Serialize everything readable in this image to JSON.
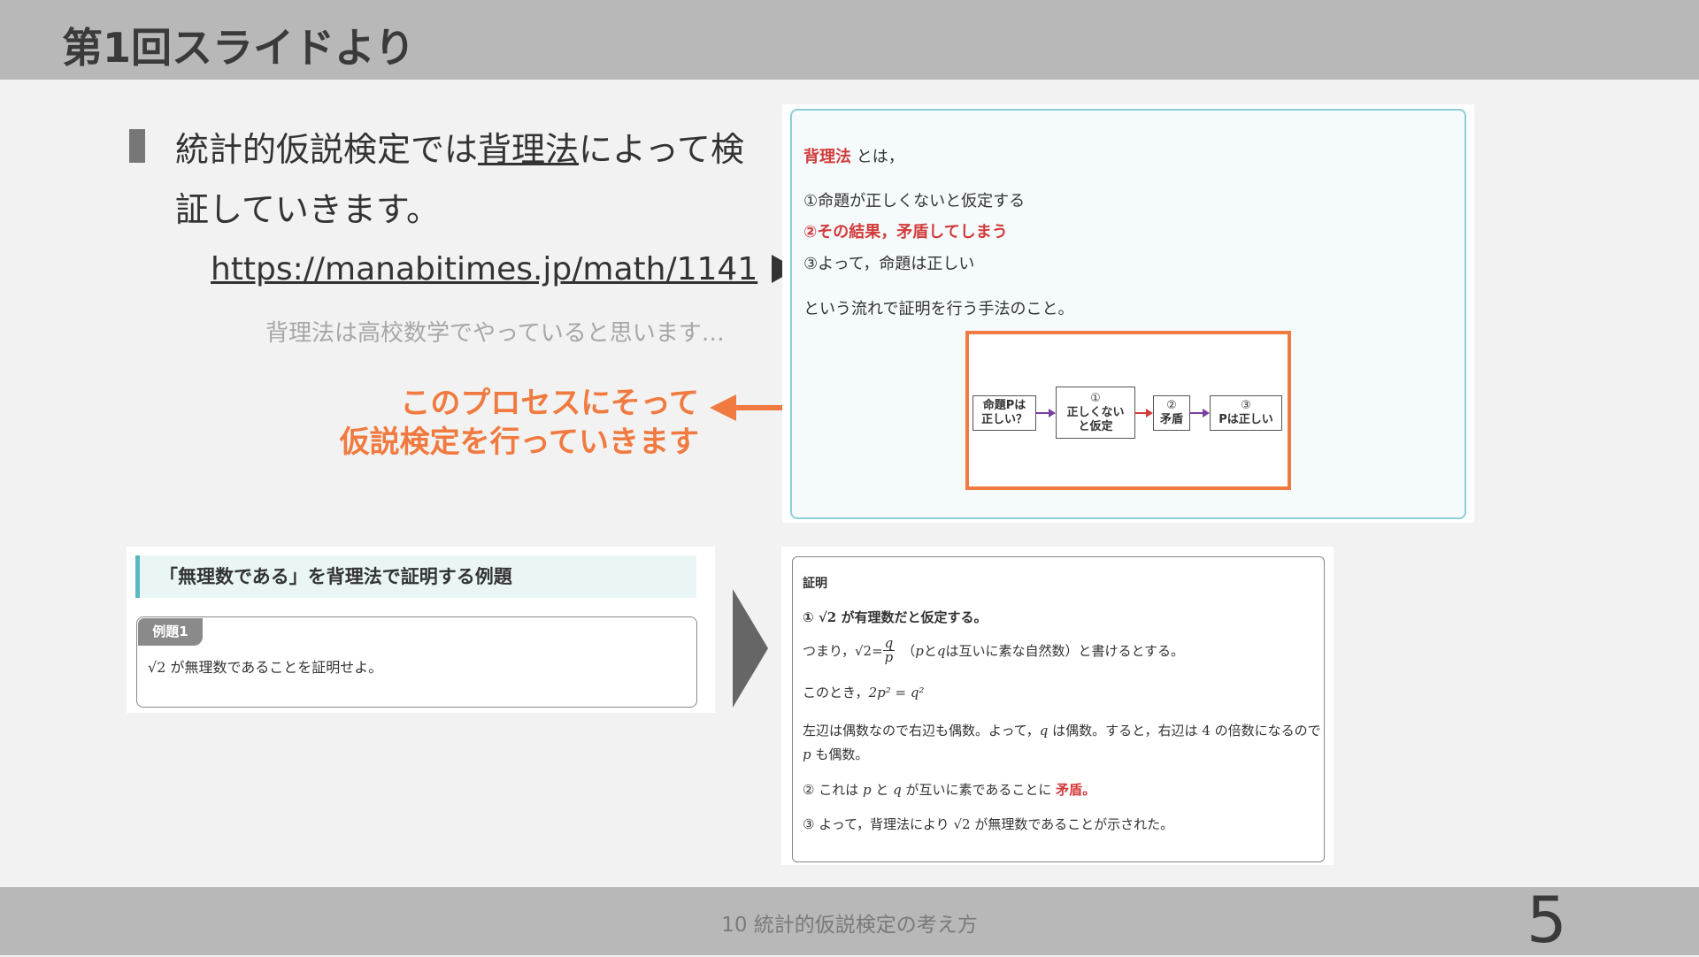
{
  "header": {
    "title": "第1回スライドより"
  },
  "bullet": {
    "text_before": "統計的仮説検定では",
    "text_underlined": "背理法",
    "text_after": "によって検証していきます。"
  },
  "link": {
    "url_text": "https://manabitimes.jp/math/1141",
    "icon": "play-icon"
  },
  "note": "背理法は高校数学でやっていると思います…",
  "callout": {
    "line1": "このプロセスにそって",
    "line2": "仮説検定を行っていきます"
  },
  "definition": {
    "term": "背理法",
    "term_suffix": "とは，",
    "step1": "①命題が正しくないと仮定する",
    "step2": "②その結果，矛盾してしまう",
    "step3": "③よって，命題は正しい",
    "summary": "という流れで証明を行う手法のこと。"
  },
  "flow": {
    "box1": "命題Pは 正しい？",
    "box2_num": "①",
    "box2": "正しくない と仮定",
    "box3_num": "②",
    "box3": "矛盾",
    "box4_num": "③",
    "box4": "Pは正しい"
  },
  "example": {
    "heading": "「無理数である」を背理法で証明する例題",
    "tag": "例題1",
    "sqrt_symbol": "√2",
    "text": " が無理数であることを証明せよ。"
  },
  "proof": {
    "title": "証明",
    "l1_prefix": "① ",
    "l1_sqrt": "√2",
    "l1_text": " が有理数だと仮定する。",
    "l2_prefix": "つまり，",
    "l2_sqrt": "√2",
    "l2_eq": " = ",
    "l2_num": "q",
    "l2_den": "p",
    "l2_mid1": "（",
    "l2_p": "p",
    "l2_and": " と ",
    "l2_q": "q",
    "l2_text": " は互いに素な自然数）と書けるとする。",
    "l3_prefix": "このとき，",
    "l3_eq": "2p² = q²",
    "l4a_text1": "左辺は偶数なので右辺も偶数。よって，",
    "l4a_q": "q",
    "l4a_text2": " は偶数。すると，右辺は ",
    "l4a_4": "4",
    "l4a_text3": " の倍数になるので",
    "l4b_p": "p",
    "l4b_text": " も偶数。",
    "l5_prefix": "② これは ",
    "l5_p": "p",
    "l5_and": " と ",
    "l5_q": "q",
    "l5_text": " が互いに素であることに ",
    "l5_red": "矛盾。",
    "l6_prefix": "③ よって，背理法により ",
    "l6_sqrt": "√2",
    "l6_text": " が無理数であることが示された。"
  },
  "footer": {
    "text": "10 統計的仮説検定の考え方",
    "page_number": "5"
  },
  "colors": {
    "accent_orange": "#f07a3f",
    "emphasis_red": "#d23b3b",
    "teal_border": "#8ccfd8",
    "header_gray": "#b8b8b8"
  }
}
